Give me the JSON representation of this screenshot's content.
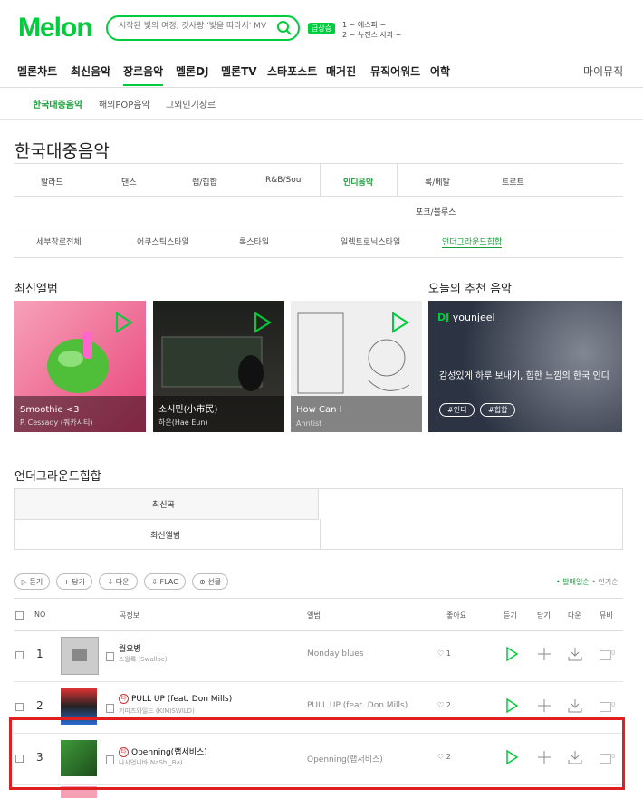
{
  "header": {
    "logo": "Melon",
    "search_placeholder": "시작된 빛의 여정, 것사랑 '빛을 따라서' MV",
    "badge": "급상승",
    "ticker": [
      "1 ~ 에스파 ~",
      "2 ~ 뉴진스 사과 ~"
    ]
  },
  "gnb": [
    "멜론차트",
    "최신음악",
    "장르음악",
    "멜론DJ",
    "멜론TV",
    "스타포스트",
    "매거진",
    "뮤직어워드",
    "어학",
    "마이뮤직"
  ],
  "lnb": [
    "한국대중음악",
    "해외POP음악",
    "그외인기장르"
  ],
  "page_title": "한국대중음악",
  "genres_row1": [
    "발라드",
    "댄스",
    "랩/힙합",
    "R&B/Soul",
    "인디음악",
    "록/메탈",
    "트로트"
  ],
  "genres_row2": [
    "포크/블루스"
  ],
  "sub_genres": [
    "세부장르전체",
    "어쿠스틱스타일",
    "록스타일",
    "일렉트로닉스타일",
    "언더그라운드힙합"
  ],
  "new_albums_title": "최신앨범",
  "recommend_title": "오늘의 추천 음악",
  "albums": [
    {
      "title": "Smoothie <3",
      "artist": "P. Cessady (쿼카시티)",
      "colors": [
        "#f06b8f",
        "#4fbf3a"
      ]
    },
    {
      "title": "소시민(小市民)",
      "artist": "하은(Hae Eun)",
      "colors": [
        "#2b2a27",
        "#555"
      ]
    },
    {
      "title": "How Can I",
      "artist": "Ahntist",
      "colors": [
        "#eeeeee",
        "#bbbbbb"
      ]
    }
  ],
  "dj": {
    "label": "DJ",
    "name": "younjeel",
    "desc": "감성있게 하루 보내기, 힙한 느낌의 한국 인디",
    "tags": [
      "#인디",
      "#힙합"
    ]
  },
  "section_title": "언더그라운드힙합",
  "section_tabs": [
    "최신곡",
    "최신앨범"
  ],
  "toolbar": {
    "buttons": [
      "듣기",
      "담기",
      "다운",
      "FLAC",
      "선물"
    ],
    "sort": [
      "발매일순",
      "인기순"
    ]
  },
  "table": {
    "headers": [
      "NO",
      "곡정보",
      "앨범",
      "좋아요",
      "듣기",
      "담기",
      "다운",
      "뮤비"
    ],
    "rows": [
      {
        "rank": "1",
        "title": "월요병",
        "artist": "스왈록 (Swalloc)",
        "album": "Monday blues",
        "likes": "1",
        "mv": "0",
        "title_badge": false
      },
      {
        "rank": "2",
        "title": "PULL UP (feat. Don Mills)",
        "artist": "키미즈와일드 (KIMISWILD)",
        "album": "PULL UP (feat. Don Mills)",
        "likes": "2",
        "mv": "0",
        "title_badge": true
      },
      {
        "rank": "3",
        "title": "Openning(랩서비스)",
        "artist": "나시언니바(NaShi_Ba)",
        "album": "Openning(랩서비스)",
        "likes": "2",
        "mv": "0",
        "title_badge": true
      }
    ],
    "badge_text": "타"
  },
  "colors": {
    "brand": "#00cd3c",
    "highlight": "#e02020"
  }
}
